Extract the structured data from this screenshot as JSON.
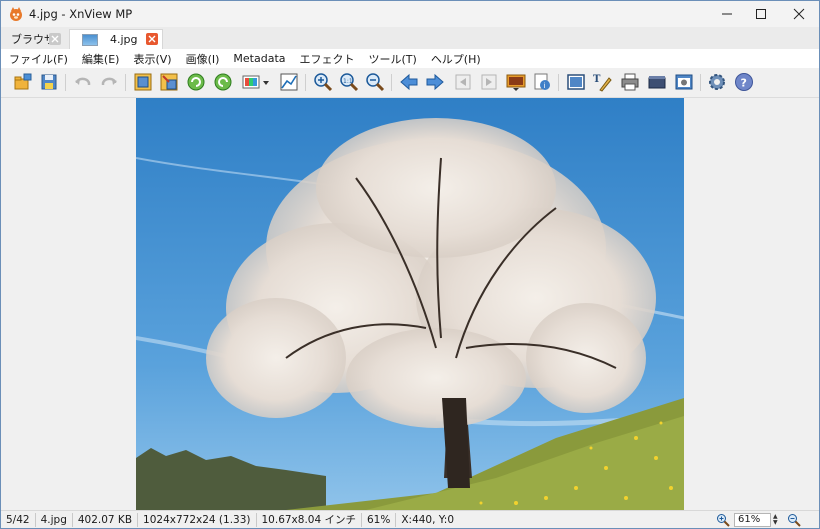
{
  "window": {
    "title": "4.jpg - XnView MP"
  },
  "tabs": [
    {
      "label": "ブラウザ",
      "active": false
    },
    {
      "label": "4.jpg",
      "active": true
    }
  ],
  "menu": [
    "ファイル(F)",
    "編集(E)",
    "表示(V)",
    "画像(I)",
    "Metadata",
    "エフェクト",
    "ツール(T)",
    "ヘルプ(H)"
  ],
  "toolbar_icons": [
    "open-folder-icon",
    "save-icon",
    "undo-icon",
    "redo-icon",
    "crop-icon",
    "resize-icon",
    "rotate-left-icon",
    "rotate-right-icon",
    "color-adjust-icon",
    "levels-icon",
    "zoom-in-icon",
    "zoom-fit-icon",
    "zoom-out-icon",
    "previous-icon",
    "next-icon",
    "first-page-icon",
    "last-page-icon",
    "slideshow-icon",
    "properties-icon",
    "fullscreen-icon",
    "text-annotate-icon",
    "print-icon",
    "scan-icon",
    "capture-icon",
    "settings-icon",
    "help-icon"
  ],
  "statusbar": {
    "position": "5/42",
    "filename": "4.jpg",
    "filesize": "402.07 KB",
    "dimensions": "1024x772x24 (1.33)",
    "print_size": "10.67x8.04 インチ",
    "zoom_pct": "61%",
    "cursor": "X:440, Y:0",
    "zoom_value": "61%"
  },
  "colors": {
    "accent_close_tab": "#e8582f",
    "sky_top": "#2f7fc6",
    "sky_bottom": "#8fc3ea",
    "grass": "#8a9a3c"
  }
}
